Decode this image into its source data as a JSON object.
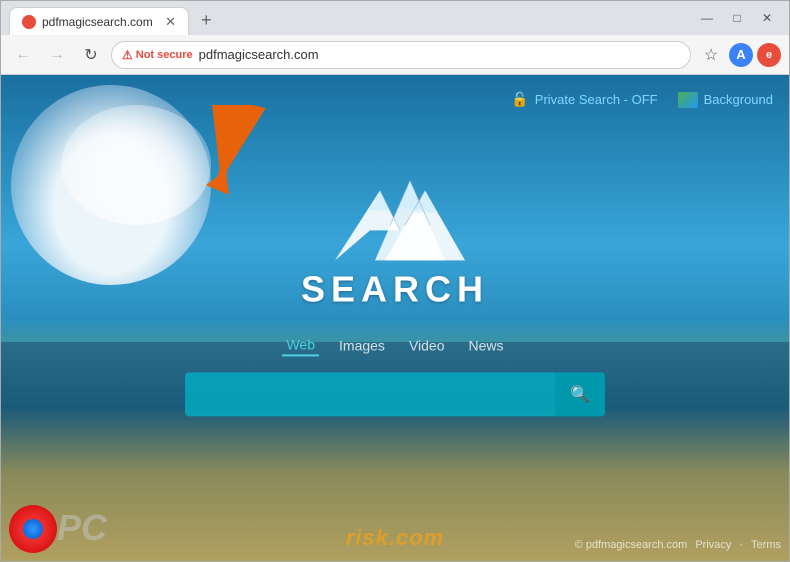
{
  "browser": {
    "tab": {
      "title": "pdfmagicsearch.com",
      "favicon": "pdf-favicon"
    },
    "new_tab_label": "+",
    "window_controls": {
      "minimize": "—",
      "maximize": "□",
      "close": "✕"
    }
  },
  "navbar": {
    "back_label": "←",
    "forward_label": "→",
    "refresh_label": "↻",
    "not_secure_label": "Not secure",
    "url": "pdfmagicsearch.com",
    "bookmark_label": "☆",
    "menu_label": "⋮"
  },
  "page": {
    "private_search_label": "Private Search - OFF",
    "background_label": "Background",
    "logo_text": "SEARCH",
    "tabs": [
      {
        "label": "Web",
        "active": true
      },
      {
        "label": "Images",
        "active": false
      },
      {
        "label": "Video",
        "active": false
      },
      {
        "label": "News",
        "active": false
      }
    ],
    "search_placeholder": "",
    "search_icon": "🔍",
    "footer": {
      "risk_text": "risk.com",
      "copyright": "© pdfmagicsearch.com",
      "links": [
        "Privacy",
        "·",
        "Terms"
      ]
    }
  },
  "colors": {
    "accent": "#4dd0e1",
    "not_secure_red": "#e74c3c",
    "background_ocean": "#1a6fa0",
    "risk_orange": "#e8a020"
  }
}
